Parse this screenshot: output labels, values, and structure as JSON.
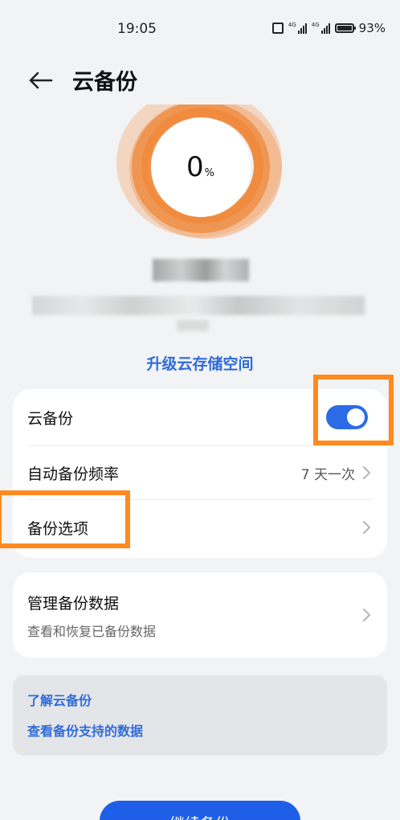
{
  "status_bar": {
    "time": "19:05",
    "network_1": "4G",
    "network_2": "4G",
    "battery": "93%",
    "icons": [
      "vibrate-icon",
      "signal-icon",
      "signal-icon",
      "battery-icon"
    ]
  },
  "header": {
    "back_icon": "arrow-left-icon",
    "title": "云备份"
  },
  "progress": {
    "value": "0",
    "unit": "%",
    "ring_color": "#f08a3c"
  },
  "upgrade_link": "升级云存储空间",
  "settings_card": {
    "cloud_backup_label": "云备份",
    "cloud_backup_enabled": true,
    "frequency_label": "自动备份频率",
    "frequency_value": "7 天一次",
    "options_label": "备份选项"
  },
  "manage_card": {
    "title": "管理备份数据",
    "subtitle": "查看和恢复已备份数据"
  },
  "info_card": {
    "learn_more": "了解云备份",
    "supported_data": "查看备份支持的数据"
  },
  "primary_button": "继续备份",
  "colors": {
    "accent": "#2c6be6",
    "link": "#2f6bd8",
    "annotation": "#ff8a1f",
    "background": "#f1f3f5"
  }
}
